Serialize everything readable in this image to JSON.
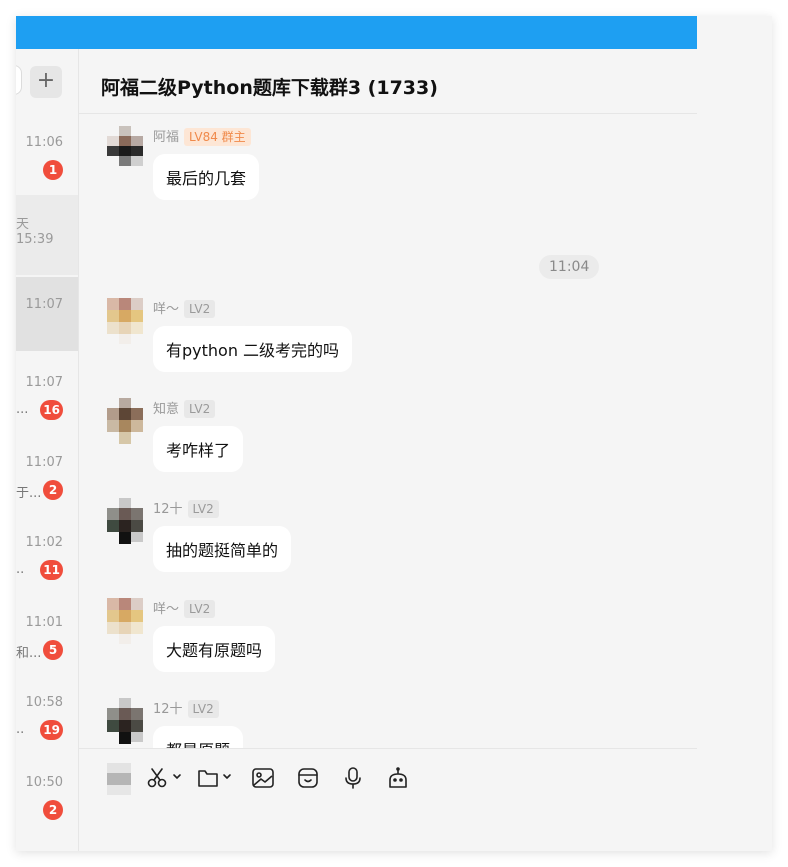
{
  "header": {
    "title": "阿福二级Python题库下载群3 (1733)"
  },
  "sidebar": {
    "conversations": [
      {
        "time": "11:06",
        "snippet": "",
        "badge": "1"
      },
      {
        "time": "天15:39",
        "snippet": "",
        "badge": ""
      },
      {
        "time": "11:07",
        "snippet": "",
        "badge": ""
      },
      {
        "time": "11:07",
        "snippet": "...",
        "badge": "16"
      },
      {
        "time": "11:07",
        "snippet": "于...",
        "badge": "2"
      },
      {
        "time": "11:02",
        "snippet": "..",
        "badge": "11"
      },
      {
        "time": "11:01",
        "snippet": "和...",
        "badge": "5"
      },
      {
        "time": "10:58",
        "snippet": "..",
        "badge": "19"
      },
      {
        "time": "10:50",
        "snippet": "",
        "badge": "2"
      }
    ]
  },
  "chat": {
    "time_separator": "11:04",
    "messages": [
      {
        "sender": "阿福",
        "level": "LV84 群主",
        "text": "最后的几套"
      },
      {
        "sender": "咩～",
        "level": "LV2",
        "text": "有python 二级考完的吗"
      },
      {
        "sender": "知意",
        "level": "LV2",
        "text": "考咋样了"
      },
      {
        "sender": "12十",
        "level": "LV2",
        "text": "抽的题挺简单的"
      },
      {
        "sender": "咩～",
        "level": "LV2",
        "text": "大题有原题吗"
      },
      {
        "sender": "12十",
        "level": "LV2",
        "text": "都是原题"
      }
    ]
  },
  "toolbar": {
    "icons": [
      "scissors-icon",
      "folder-icon",
      "image-icon",
      "sticker-icon",
      "microphone-icon",
      "robot-icon"
    ]
  },
  "colors": {
    "topbar": "#1e9ff2",
    "badge": "#f04d3c",
    "owner_tag_bg": "#fde6d5",
    "owner_tag_text": "#f08a4b"
  }
}
